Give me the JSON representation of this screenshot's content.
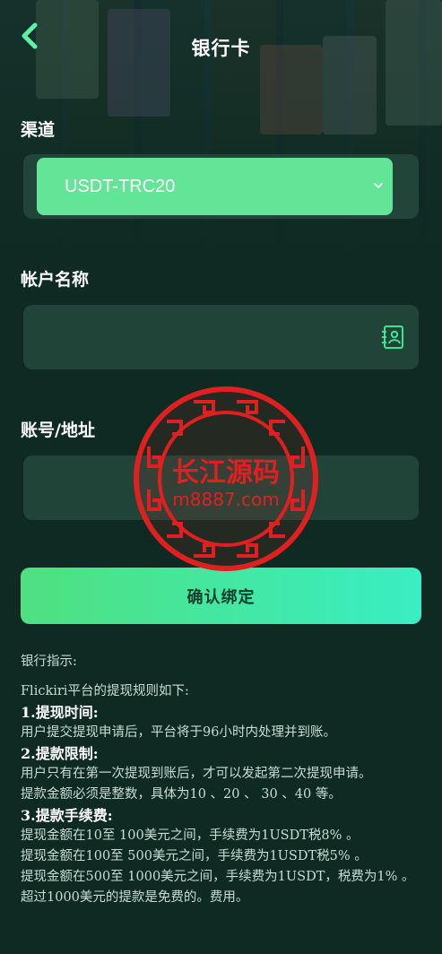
{
  "header": {
    "title": "银行卡"
  },
  "form": {
    "channel_label": "渠道",
    "channel_value": "USDT-TRC20",
    "account_name_label": "帐户名称",
    "account_name_value": "",
    "address_label": "账号/地址",
    "address_value": "",
    "confirm_label": "确认绑定"
  },
  "instructions": {
    "heading": "银行指示:",
    "intro": "Flickiri平台的提现规则如下:",
    "section1_title": "1.提现时间:",
    "section1_text": "用户提交提现申请后，平台将于96小时内处理并到账。",
    "section2_title": "2.提款限制:",
    "section2_text1": "用户只有在第一次提现到账后，才可以发起第二次提现申请。",
    "section2_text2": "提款金额必须是整数，具体为10 、20 、 30 、40 等。",
    "section3_title": "3.提款手续费:",
    "section3_text1": "提现金额在10至 100美元之间，手续费为1USDT税8% 。",
    "section3_text2": "提现金额在100至 500美元之间，手续费为1USDT税5% 。",
    "section3_text3": "提现金额在500至 1000美元之间，手续费为1USDT，税费为1% 。",
    "section3_text4": "超过1000美元的提款是免费的。费用。"
  },
  "watermark": {
    "line1": "长江源码",
    "line2": "m8887.com"
  },
  "colors": {
    "background": "#0e2a22",
    "accent": "#62e597",
    "button_start": "#4fe07f",
    "button_end": "#39eec2",
    "watermark": "#e02020"
  },
  "icons": {
    "back": "chevron-left-icon",
    "select_arrow": "chevron-down-icon",
    "contact": "contact-card-icon"
  }
}
